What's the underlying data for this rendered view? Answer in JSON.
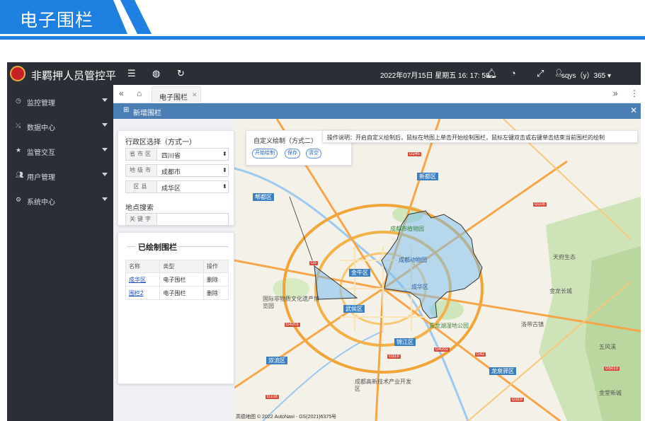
{
  "banner": {
    "title": "电子围栏"
  },
  "app": {
    "title": "非羁押人员管控平",
    "datetime": "2022年07月15日 星期五 16: 17: 58",
    "user": "sqys（y）365"
  },
  "topbar_icons": [
    "menu-icon",
    "globe-icon",
    "refresh-icon",
    "bell-icon",
    "dashboard-icon",
    "fullscreen-icon",
    "user-icon"
  ],
  "sidebar": {
    "items": [
      {
        "label": "监控管理",
        "icon": "monitor-icon"
      },
      {
        "label": "数据中心",
        "icon": "data-icon"
      },
      {
        "label": "监管交互",
        "icon": "star-icon"
      },
      {
        "label": "用户管理",
        "icon": "users-icon"
      },
      {
        "label": "系统中心",
        "icon": "gear-icon"
      }
    ]
  },
  "tabs": {
    "active_label": "电子围栏"
  },
  "panel": {
    "title": "新增围栏"
  },
  "region_select": {
    "title": "行政区选择（方式一）",
    "rows": [
      {
        "key": "省市区",
        "value": "四川省"
      },
      {
        "key": "地级市",
        "value": "成都市"
      },
      {
        "key": "区县",
        "value": "成华区"
      }
    ]
  },
  "place_search": {
    "title": "地点搜索",
    "key": "关键字",
    "value": ""
  },
  "fences": {
    "title": "已绘制围栏",
    "columns": [
      "名称",
      "类型",
      "操作"
    ],
    "rows": [
      {
        "name": "成华区",
        "type": "电子围栏",
        "action": "删除"
      },
      {
        "name": "围栏2",
        "type": "电子围栏",
        "action": "删除"
      }
    ]
  },
  "custom_draw": {
    "title": "自定义绘制（方式二）",
    "buttons": [
      "开始绘制",
      "保存",
      "清空"
    ]
  },
  "instructions": "操作说明：开启自定义绘制后，鼠标在地图上单击开始绘制围栏，鼠标左键双击或右键单击结束当前围栏的绘制",
  "map": {
    "labels": [
      "成都市植物园",
      "成都动物园",
      "天府生态",
      "金龙长城",
      "成华区",
      "青龙湖湿地公园",
      "洛带古镇",
      "国际非物质文化遗产博览园",
      "成都高新技术产业开发区",
      "五风溪",
      "金堂新城"
    ],
    "districts": [
      "郫都区",
      "新都区",
      "金牛区",
      "武侯区",
      "锦江区",
      "双流区",
      "龙泉驿区"
    ],
    "shields": [
      "G245",
      "G108",
      "G4201",
      "G5",
      "G42",
      "G4202",
      "G318",
      "G5013",
      "G319",
      "G108"
    ],
    "copyright": "高德地图 © 2022 AutoNavi - GS(2021)6375号"
  }
}
